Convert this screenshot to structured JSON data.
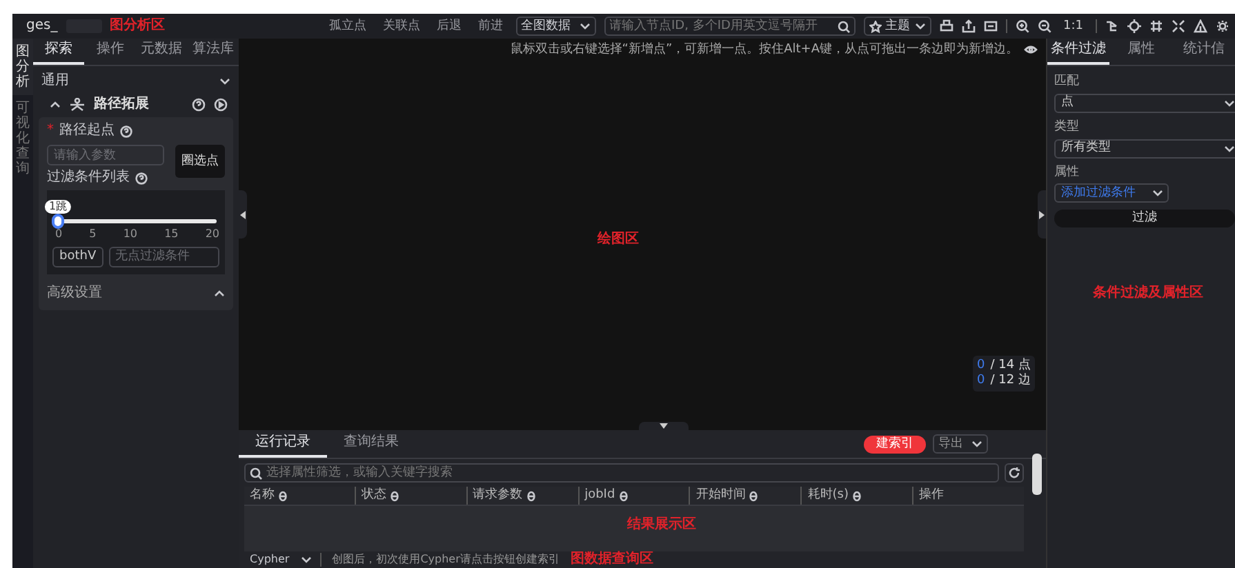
{
  "top_bar": {
    "app_title": "ges_",
    "annotation": "图分析区",
    "toolbar_buttons": [
      "孤立点",
      "关联点",
      "后退",
      "前进"
    ],
    "scope_select": "全图数据",
    "node_search": {
      "placeholder": "请输入节点ID, 多个ID用英文逗号隔开"
    },
    "theme_select": "主题",
    "actual_size": "1:1"
  },
  "side_tabs": [
    {
      "label": "图分析",
      "selected": true
    },
    {
      "label": "可视化查询",
      "selected": false
    }
  ],
  "left_panel": {
    "tabs": [
      {
        "label": "探索",
        "selected": true
      },
      {
        "label": "操作",
        "selected": false
      },
      {
        "label": "元数据",
        "selected": false
      },
      {
        "label": "算法库",
        "selected": false
      }
    ],
    "section": {
      "title": "通用",
      "expanded": true
    },
    "tool": {
      "title": "路径拓展",
      "expanded": true
    },
    "required_mark": "*",
    "start_label": "路径起点",
    "start_field": {
      "placeholder": "请输入参数"
    },
    "pick_button": "圈选点",
    "filter_label": "过滤条件列表",
    "hop_tooltip": "1跳",
    "hop_slider": {
      "level": 0
    },
    "slider_ticks": [
      "0",
      "5",
      "10",
      "15",
      "20"
    ],
    "direction_select": "bothV",
    "filter_field": {
      "placeholder": "无点过滤条件"
    },
    "advanced": {
      "title": "高级设置",
      "expanded": false
    }
  },
  "canvas": {
    "hint": "鼠标双击或右键选择“新增点”，可新增一点。按住Alt+A键，从点可拖出一条边即为新增边。",
    "annotation": "绘图区",
    "counters": [
      {
        "selected": "0",
        "total": "/ 14 点"
      },
      {
        "selected": "0",
        "total": "/ 12 边"
      }
    ]
  },
  "bottom_panel": {
    "tabs": [
      {
        "label": "运行记录",
        "selected": true
      },
      {
        "label": "查询结果",
        "selected": false
      }
    ],
    "index_button": "建索引",
    "export_select": "导出",
    "search": {
      "placeholder": "选择属性筛选，或输入关键字搜索"
    },
    "table": {
      "columns": [
        "名称",
        "状态",
        "请求参数",
        "jobId",
        "开始时间",
        "耗时(s)",
        "操作"
      ]
    },
    "annotation": "结果展示区",
    "query_language": "Cypher",
    "query_hint": "创图后，初次使用Cypher请点击按钮创建索引",
    "query_annotation": "图数据查询区"
  },
  "right_panel": {
    "tabs": [
      {
        "label": "条件过滤",
        "selected": true
      },
      {
        "label": "属性",
        "selected": false
      },
      {
        "label": "统计信",
        "selected": false
      }
    ],
    "fields": [
      {
        "label": "匹配",
        "value": "点",
        "kind": "select"
      },
      {
        "label": "类型",
        "value": "所有类型",
        "kind": "select"
      },
      {
        "label": "属性",
        "value": "添加过滤条件",
        "kind": "link-select"
      }
    ],
    "filter_button": "过滤",
    "annotation": "条件过滤及属性区"
  }
}
